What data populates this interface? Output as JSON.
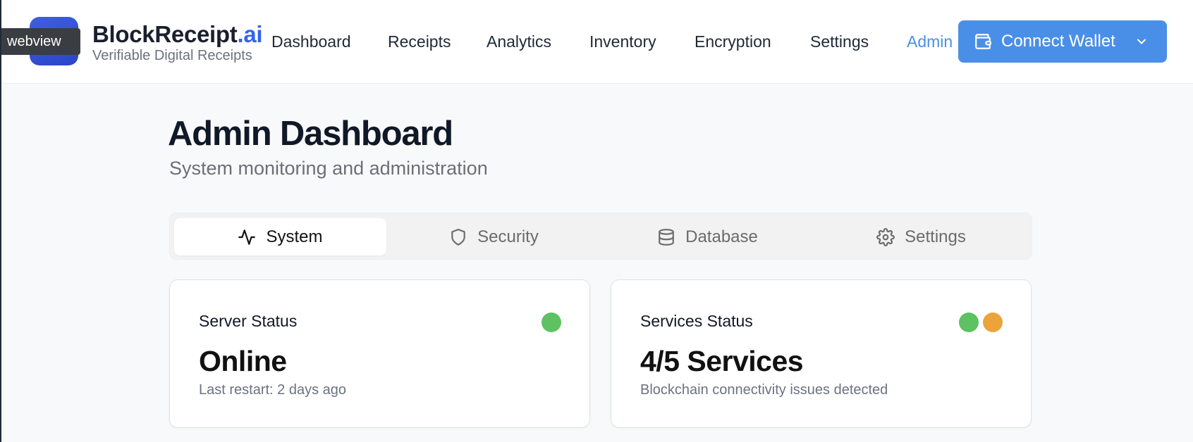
{
  "overlay": {
    "webview_label": "webview"
  },
  "brand": {
    "name_main": "BlockReceipt",
    "name_accent": ".ai",
    "tagline": "Verifiable Digital Receipts",
    "accent_color": "#3563e9"
  },
  "nav": {
    "items": [
      {
        "label": "Dashboard",
        "active": false
      },
      {
        "label": "Receipts",
        "active": false
      },
      {
        "label": "Analytics",
        "active": false
      },
      {
        "label": "Inventory",
        "active": false
      },
      {
        "label": "Encryption",
        "active": false
      },
      {
        "label": "Settings",
        "active": false
      },
      {
        "label": "Admin",
        "active": true
      }
    ],
    "active_color": "#4a90e2"
  },
  "wallet": {
    "label": "Connect Wallet",
    "icon": "wallet-icon",
    "color": "#4a8fe7"
  },
  "page": {
    "title": "Admin Dashboard",
    "subtitle": "System monitoring and administration"
  },
  "tabs": [
    {
      "label": "System",
      "icon": "activity-icon",
      "active": true
    },
    {
      "label": "Security",
      "icon": "shield-icon",
      "active": false
    },
    {
      "label": "Database",
      "icon": "database-icon",
      "active": false
    },
    {
      "label": "Settings",
      "icon": "gear-icon",
      "active": false
    }
  ],
  "cards": {
    "server": {
      "title": "Server Status",
      "value": "Online",
      "note": "Last restart: 2 days ago",
      "indicators": [
        "#5ec162"
      ]
    },
    "services": {
      "title": "Services Status",
      "value": "4/5 Services",
      "note": "Blockchain connectivity issues detected",
      "indicators": [
        "#5ec162",
        "#eba43a"
      ]
    }
  }
}
